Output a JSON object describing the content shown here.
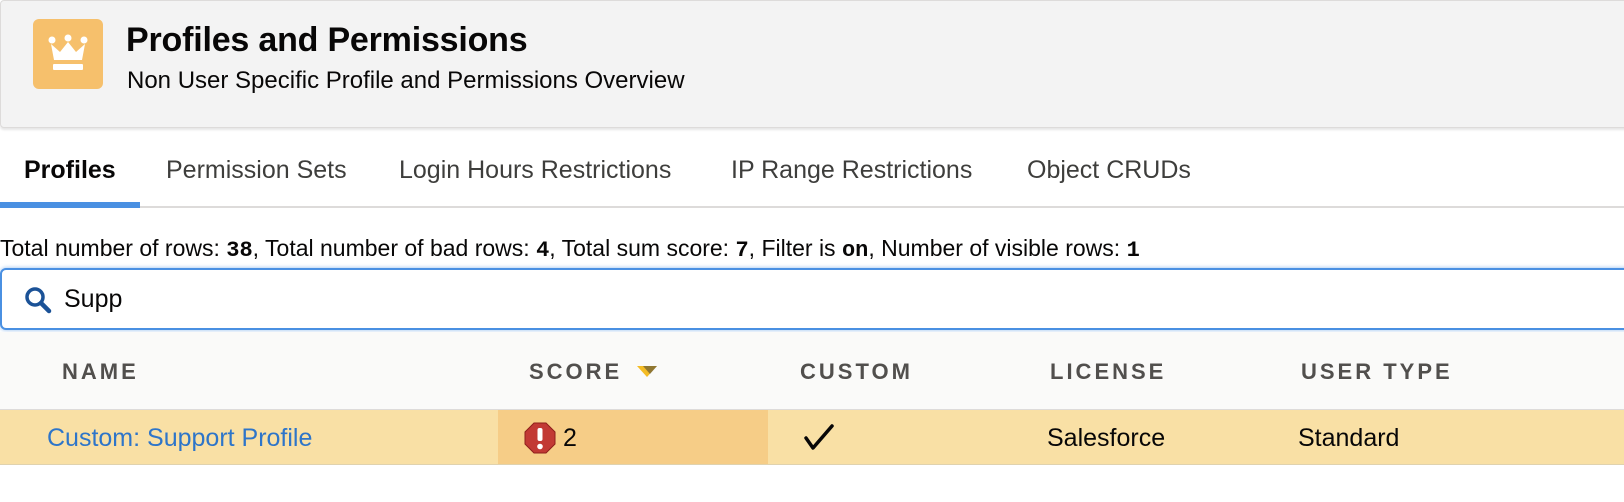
{
  "header": {
    "title": "Profiles and Permissions",
    "subtitle": "Non User Specific Profile and Permissions Overview",
    "icon": "crown-icon",
    "icon_color": "#f6c06c"
  },
  "tabs": [
    {
      "label": "Profiles",
      "active": true
    },
    {
      "label": "Permission Sets",
      "active": false
    },
    {
      "label": "Login Hours Restrictions",
      "active": false
    },
    {
      "label": "IP Range Restrictions",
      "active": false
    },
    {
      "label": "Object CRUDs",
      "active": false
    }
  ],
  "summary": {
    "total_rows_label": "Total number of rows: ",
    "total_rows": "38",
    "bad_rows_label": ", Total number of bad rows: ",
    "bad_rows": "4",
    "sum_score_label": ", Total sum score: ",
    "sum_score": "7",
    "filter_label": ", Filter is ",
    "filter": "on",
    "visible_rows_label": ", Number of visible rows: ",
    "visible_rows": "1"
  },
  "search": {
    "value": "Supp",
    "icon": "search-icon"
  },
  "table": {
    "columns": [
      "NAME",
      "SCORE",
      "CUSTOM",
      "LICENSE",
      "USER TYPE"
    ],
    "sorted_column": "SCORE",
    "rows": [
      {
        "name": "Custom: Support Profile",
        "score": "2",
        "score_icon": "warning-icon",
        "custom": true,
        "license": "Salesforce",
        "user_type": "Standard"
      }
    ]
  },
  "colors": {
    "accent": "#4a90e2",
    "row_highlight": "#f9e0a5",
    "score_highlight": "#f6cd87",
    "link": "#2e75c9",
    "warning": "#c23934"
  }
}
